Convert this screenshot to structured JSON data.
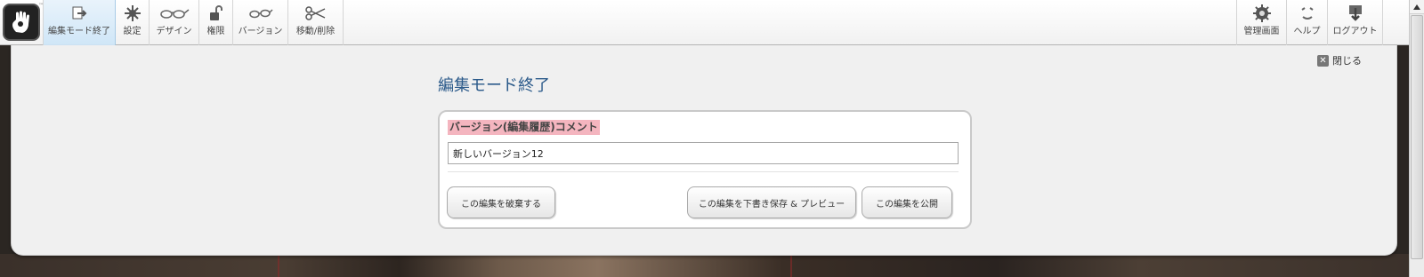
{
  "toolbar": {
    "logo_tm": "™",
    "left_items": [
      {
        "label": "編集モード終了",
        "icon": "exit-edit-icon",
        "active": true
      },
      {
        "label": "設定",
        "icon": "gear-icon"
      },
      {
        "label": "デザイン",
        "icon": "glasses-icon"
      },
      {
        "label": "権限",
        "icon": "lock-icon"
      },
      {
        "label": "バージョン",
        "icon": "versions-icon"
      },
      {
        "label": "移動/削除",
        "icon": "scissors-icon"
      }
    ],
    "right_items": [
      {
        "label": "管理画面",
        "icon": "dashboard-gear-icon"
      },
      {
        "label": "ヘルプ",
        "icon": "help-icon"
      },
      {
        "label": "ログアウト",
        "icon": "logout-icon"
      }
    ]
  },
  "panel": {
    "close_label": "閉じる",
    "close_icon": "close-icon",
    "title": "編集モード終了",
    "comment_label": "バージョン(編集履歴)コメント",
    "comment_value": "新しいバージョン12",
    "buttons": {
      "discard": "この編集を破棄する",
      "save_preview": "この編集を下書き保存 & プレビュー",
      "publish": "この編集を公開"
    }
  },
  "colors": {
    "title": "#2b5a8a",
    "label_highlight": "#f4b5bf",
    "active_tab": "#cfe6f7"
  }
}
